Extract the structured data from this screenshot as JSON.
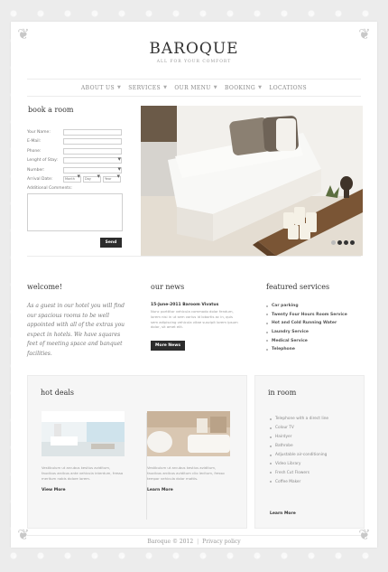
{
  "brand": {
    "name": "BAROQUE",
    "tagline": "ALL FOR YOUR COMFORT"
  },
  "nav": [
    {
      "label": "ABOUT US"
    },
    {
      "label": "SERVICES"
    },
    {
      "label": "OUR MENU"
    },
    {
      "label": "BOOKING"
    },
    {
      "label": "LOCATIONS"
    }
  ],
  "booking": {
    "title": "book a room",
    "fields": {
      "name": "Your Name:",
      "email": "E-Mail:",
      "phone": "Phone:",
      "stay": "Lenght of Stay:",
      "number": "Number:",
      "arrival": "Arrival Date:"
    },
    "date": {
      "month": "Month",
      "day": "Day",
      "year": "Year"
    },
    "comments": "Additional Comments:",
    "send": "Send"
  },
  "slider": {
    "active_index": 2,
    "count": 4
  },
  "welcome": {
    "title": "welcome!",
    "text": "As a guest in our hotel you will find our spacious rooms to be well appointed with all of the extras you expect in hotels. We have squares feet of meeting space and banquet facilities."
  },
  "news": {
    "title": "our news",
    "item_title": "15-June-2011 Baroom Vivatus",
    "text": "Nunc porttitor vehicula commodo dolor fendum, lorem nisi in ut sem varius id lobortis ac in, quis sem adipiscing vehicula vitae suscipit lorem ipsum dolor, sit amet elit.",
    "button": "More News"
  },
  "services": {
    "title": "featured services",
    "items": [
      "Car parking",
      "Twenty Four Hours Room Service",
      "Hot and Cold Running Water",
      "Laundry Service",
      "Medical Service",
      "Telephone"
    ]
  },
  "deals": {
    "title": "hot deals",
    "items": [
      {
        "text": "Vestibulum ut arcubus kestius aviditum, faucibus arcibus ante vehicula interdum, fresso meritum nobis dolore lorem.",
        "link": "View More"
      },
      {
        "text": "Vestibulum ut arcubus kestius aviditum, faucibus arcibus aviditum clio lecitum, fresso tempor vehicula dolor mattis.",
        "link": "Learn More"
      }
    ]
  },
  "inroom": {
    "title": "in room",
    "items": [
      "Telephone with a direct line",
      "Colour TV",
      "Hairdyer",
      "Bathrobe",
      "Adjustable air-conditioning",
      "Video Library",
      "Fresh Cut Flowers",
      "Coffee Maker"
    ],
    "link": "Learn More"
  },
  "footer": {
    "text": "Baroque © 2012",
    "link": "Privacy policy"
  }
}
